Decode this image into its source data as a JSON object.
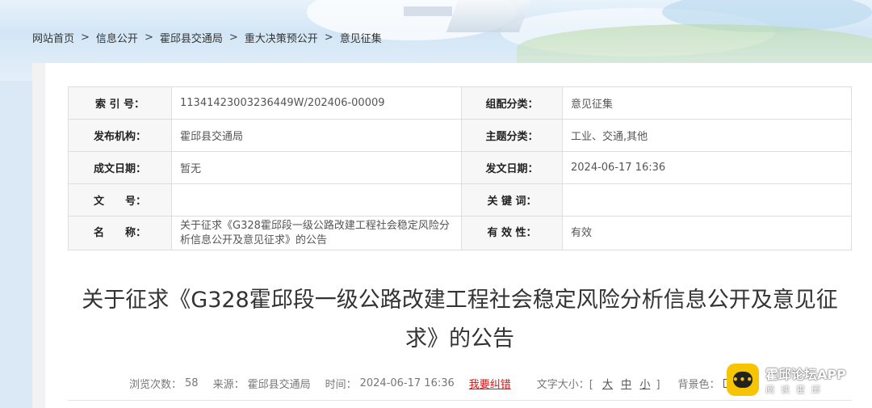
{
  "breadcrumb": {
    "items": [
      "网站首页",
      "信息公开",
      "霍邱县交通局",
      "重大决策预公开",
      "意见征集"
    ],
    "separator": ">"
  },
  "meta_table": {
    "rows": [
      {
        "label1": "索 引 号：",
        "value1": "11341423003236449W/202406-00009",
        "label2": "组配分类：",
        "value2": "意见征集"
      },
      {
        "label1": "发布机构：",
        "value1": "霍邱县交通局",
        "label2": "主题分类：",
        "value2": "工业、交通,其他"
      },
      {
        "label1": "成文日期：",
        "value1": "暂无",
        "label2": "发文日期：",
        "value2": "2024-06-17 16:36"
      },
      {
        "label1": "文　　号：",
        "value1": "",
        "label2": "关 键 词：",
        "value2": ""
      },
      {
        "label1": "名　　称：",
        "value1": "关于征求《G328霍邱段一级公路改建工程社会稳定风险分析信息公开及意见征求》的公告",
        "label2": "有 效 性：",
        "value2": "有效"
      }
    ]
  },
  "article": {
    "title": "关于征求《G328霍邱段一级公路改建工程社会稳定风险分析信息公开及意见征求》的公告"
  },
  "info_bar": {
    "views_label": "浏览次数：",
    "views": "58",
    "source_label": "来源：",
    "source": "霍邱县交通局",
    "time_label": "时间：",
    "time": "2024-06-17 16:36",
    "error_link": "我要纠错",
    "font_size_label": "文字大小：[",
    "font_large": "大",
    "font_medium": "中",
    "font_small": "小",
    "font_size_end": "]",
    "bg_color_label": "背景色："
  },
  "watermark": {
    "logo_text": "•••",
    "title": "霍邱论坛APP",
    "subtitle": "阅读霍邱"
  }
}
